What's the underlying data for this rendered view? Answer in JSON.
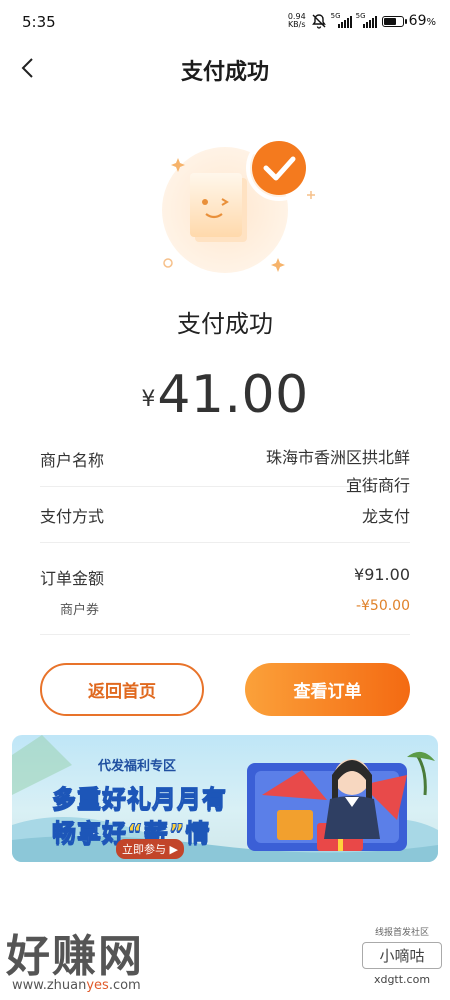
{
  "status_bar": {
    "time": "5:35",
    "net_speed_value": "0.94",
    "net_speed_unit": "KB/s",
    "signal1_label": "5G",
    "signal2_label": "5G",
    "battery_percent": "69",
    "battery_percent_suffix": "%",
    "battery_level": 0.69
  },
  "header": {
    "title": "支付成功",
    "back_icon": "chevron-left-icon"
  },
  "result": {
    "status_text": "支付成功",
    "currency_symbol": "¥",
    "amount": "41.00"
  },
  "details": {
    "merchant_label": "商户名称",
    "merchant_value_line1": "珠海市香洲区拱北鲜",
    "merchant_value_line2": "宜街商行",
    "pay_method_label": "支付方式",
    "pay_method_value": "龙支付",
    "order_amount_label": "订单金额",
    "order_amount_value": "¥91.00",
    "coupon_label": "商户券",
    "coupon_value": "-¥50.00"
  },
  "buttons": {
    "home_label": "返回首页",
    "order_label": "查看订单"
  },
  "banner": {
    "tag": "代发福利专区",
    "line1": "多重好礼月月有",
    "line2_prefix": "畅享好",
    "line2_highlight": "“薪”",
    "line2_suffix": "情",
    "join_label": "立即参与 ▶"
  },
  "watermark": {
    "left_big": "好赚网",
    "left_url_prefix": "www.zhuan",
    "left_url_accent": "yes",
    "left_url_suffix": ".com",
    "right_top": "线报首发社区",
    "right_box": "小嘀咕",
    "right_domain": "xdgtt.com"
  },
  "colors": {
    "accent_orange": "#f47a1e",
    "coupon_orange": "#e0822a"
  }
}
